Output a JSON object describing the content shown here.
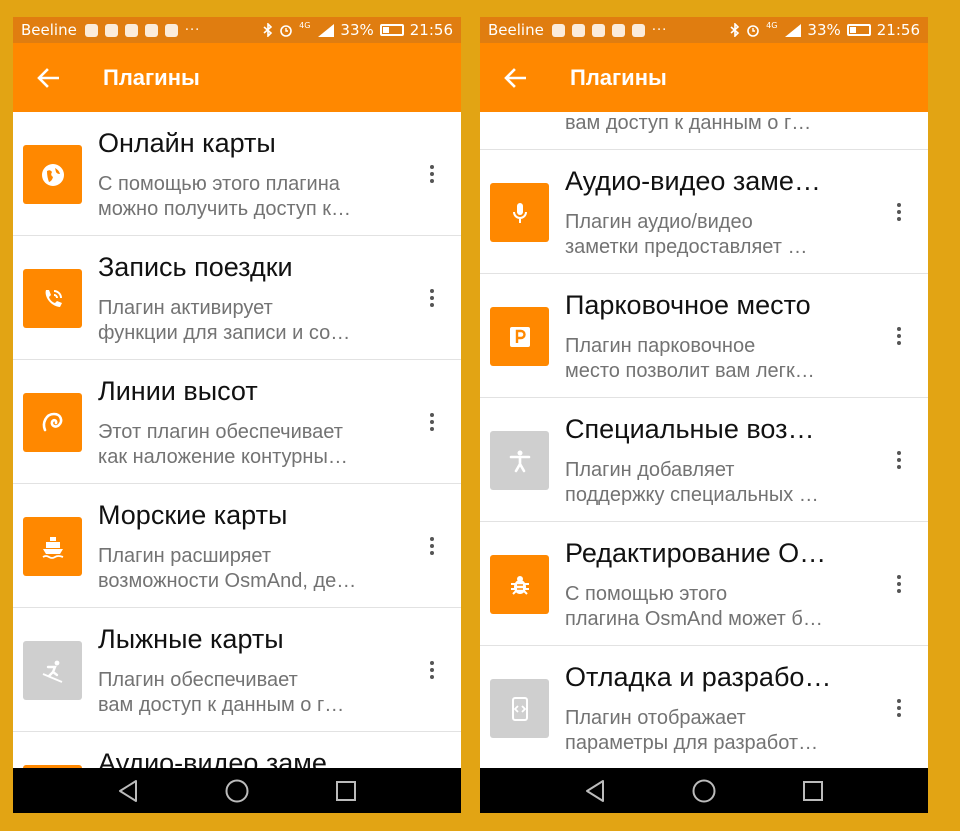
{
  "colors": {
    "frame_background": "#e2a414",
    "statusbar": "#e07d10",
    "appbar": "#ff8800",
    "icon_active": "#ff8800",
    "icon_inactive": "#cfcfcf"
  },
  "left": {
    "status": {
      "carrier": "Beeline",
      "network": "4G",
      "battery": "33%",
      "time": "21:56"
    },
    "appbar": {
      "back_icon": "arrow-back-icon",
      "title": "Плагины"
    },
    "items": [
      {
        "name": "Онлайн карты",
        "desc1": "С помощью этого плагина",
        "desc2": "можно получить доступ к…",
        "icon": "globe-icon",
        "active": true
      },
      {
        "name": "Запись поездки",
        "desc1": "Плагин активирует",
        "desc2": "функции для записи и со…",
        "icon": "trip-record-icon",
        "active": true
      },
      {
        "name": "Линии высот",
        "desc1": "Этот плагин обеспечивает",
        "desc2": "как наложение контурны…",
        "icon": "contour-icon",
        "active": true
      },
      {
        "name": "Морские карты",
        "desc1": "Плагин расширяет",
        "desc2": "возможности OsmAnd, де…",
        "icon": "ship-icon",
        "active": true
      },
      {
        "name": "Лыжные карты",
        "desc1": "Плагин обеспечивает",
        "desc2": "вам доступ к данным о г…",
        "icon": "skier-icon",
        "active": false
      },
      {
        "name": "Аудио-видео заме…",
        "desc1": "",
        "desc2": "",
        "icon": "mic-icon",
        "active": true
      }
    ]
  },
  "right": {
    "status": {
      "carrier": "Beeline",
      "network": "4G",
      "battery": "33%",
      "time": "21:56"
    },
    "appbar": {
      "back_icon": "arrow-back-icon",
      "title": "Плагины"
    },
    "partial_top": "вам доступ к данным о г…",
    "items": [
      {
        "name": "Аудио-видео заме…",
        "desc1": "Плагин аудио/видео",
        "desc2": "заметки предоставляет …",
        "icon": "mic-icon",
        "active": true
      },
      {
        "name": "Парковочное место",
        "desc1": "Плагин парковочное",
        "desc2": "место позволит вам легк…",
        "icon": "parking-icon",
        "active": true
      },
      {
        "name": "Специальные воз…",
        "desc1": "Плагин добавляет",
        "desc2": "поддержку специальных …",
        "icon": "accessibility-icon",
        "active": false
      },
      {
        "name": "Редактирование О…",
        "desc1": "С помощью этого",
        "desc2": "плагина OsmAnd может б…",
        "icon": "bug-icon",
        "active": true
      },
      {
        "name": "Отладка и разрабо…",
        "desc1": "Плагин отображает",
        "desc2": "параметры для разработ…",
        "icon": "developer-icon",
        "active": false
      }
    ]
  }
}
